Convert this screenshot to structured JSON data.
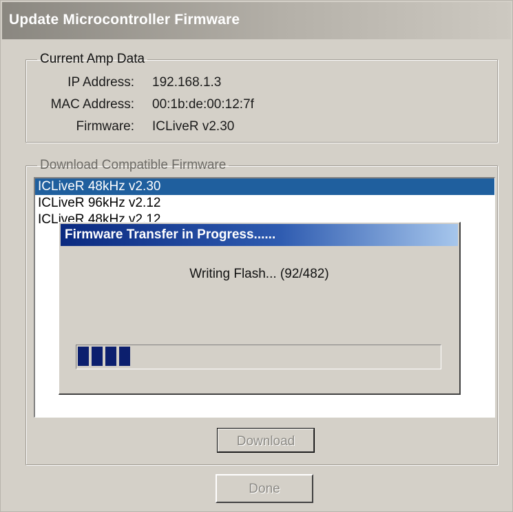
{
  "window": {
    "title": "Update Microcontroller Firmware"
  },
  "amp_group": {
    "legend": "Current Amp Data",
    "rows": [
      {
        "label": "IP Address:",
        "value": "192.168.1.3"
      },
      {
        "label": "MAC Address:",
        "value": "00:1b:de:00:12:7f"
      },
      {
        "label": "Firmware:",
        "value": "ICLiveR v2.30"
      }
    ]
  },
  "download_group": {
    "legend": "Download Compatible Firmware",
    "list": [
      {
        "label": "ICLiveR 48kHz v2.30",
        "selected": true
      },
      {
        "label": "ICLiveR 96kHz v2.12",
        "selected": false
      },
      {
        "label": "ICLiveR 48kHz v2.12",
        "selected": false
      }
    ],
    "download_label": "Download"
  },
  "progress_dialog": {
    "title": "Firmware Transfer in Progress......",
    "status": "Writing Flash... (92/482)",
    "progress_fraction": 0.19,
    "bar_color": "#0c1f6e"
  },
  "done_label": "Done"
}
